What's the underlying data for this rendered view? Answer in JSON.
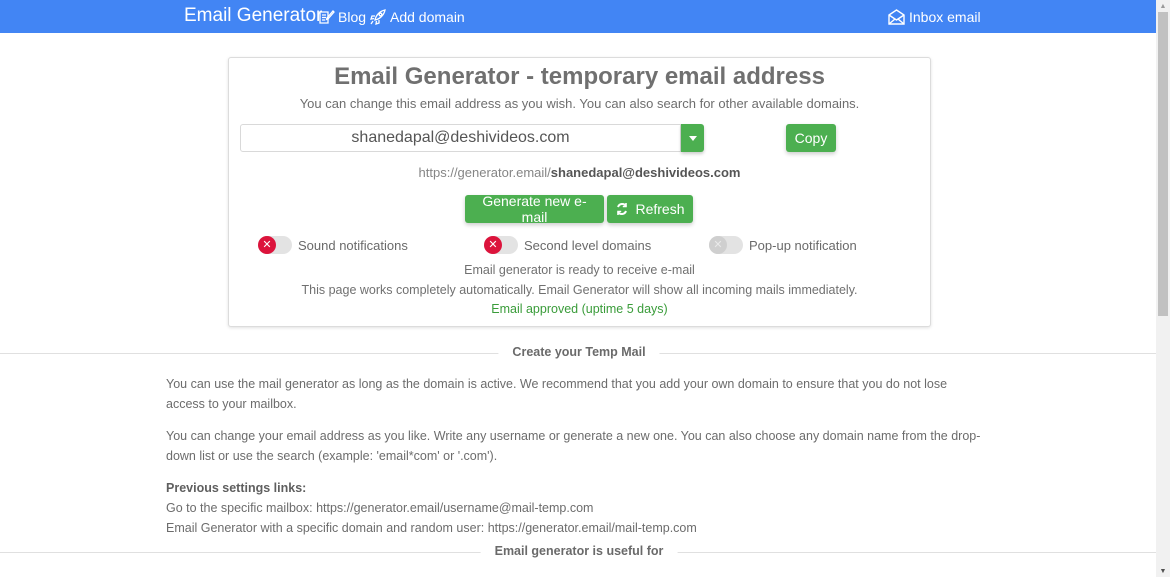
{
  "navbar": {
    "brand": "Email Generator",
    "links": [
      {
        "label": "Blog",
        "icon": "blog-icon"
      },
      {
        "label": "Add domain",
        "icon": "rocket-icon"
      }
    ],
    "inbox": {
      "label": "Inbox email",
      "icon": "envelope-open-icon"
    },
    "color": "#4285f4"
  },
  "card": {
    "title": "Email Generator - temporary email address",
    "subtitle": "You can change this email address as you wish. You can also search for other available domains.",
    "email_value": "shanedapal@deshivideos.com",
    "copy_label": "Copy",
    "mailbox_url_prefix": "https://generator.email/",
    "mailbox_url_email": "shanedapal@deshivideos.com",
    "generate_label": "Generate new e-mail",
    "refresh_label": "Refresh",
    "toggles": [
      {
        "label": "Sound notifications",
        "state": "off"
      },
      {
        "label": "Second level domains",
        "state": "off"
      },
      {
        "label": "Pop-up notification",
        "state": "disabled"
      }
    ],
    "status_ready": "Email generator is ready to receive e-mail",
    "status_auto": "This page works completely automatically. Email Generator will show all incoming mails immediately.",
    "status_approved": "Email approved (uptime 5 days)",
    "accent_color": "#4caf50",
    "toggle_off_color": "#dc143c",
    "approved_color": "#3a9c3a"
  },
  "sections": {
    "create_heading": "Create your Temp Mail",
    "para1": "You can use the mail generator as long as the domain is active. We recommend that you add your own domain to ensure that you do not lose access to your mailbox.",
    "para2": "You can change your email address as you like. Write any username or generate a new one. You can also choose any domain name from the drop-down list or use the search (example: 'email*com' or '.com').",
    "prev_links_heading": "Previous settings links:",
    "prev_link1_label": "Go to the specific mailbox: ",
    "prev_link1_url": "https://generator.email/username@mail-temp.com",
    "prev_link2_label": "Email Generator with a specific domain and random user: ",
    "prev_link2_url": "https://generator.email/mail-temp.com",
    "useful_heading": "Email generator is useful for"
  }
}
